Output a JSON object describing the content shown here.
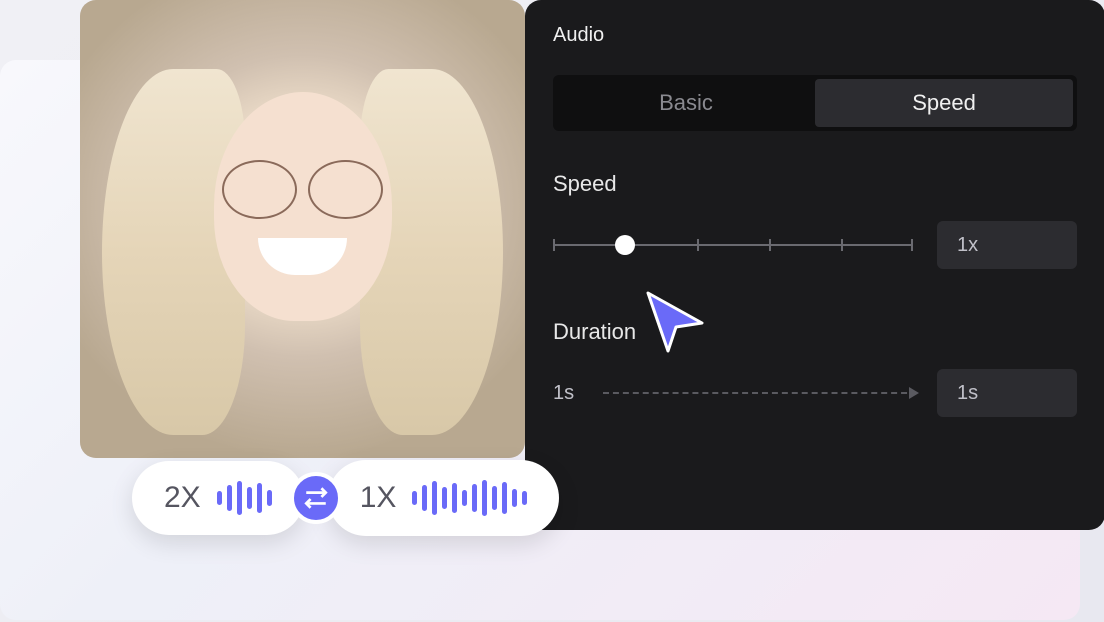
{
  "panel": {
    "title": "Audio",
    "tabs": {
      "basic": "Basic",
      "speed": "Speed",
      "active": "speed"
    },
    "speed": {
      "label": "Speed",
      "value": "1x"
    },
    "duration": {
      "label": "Duration",
      "start": "1s",
      "end": "1s"
    }
  },
  "pills": {
    "speed_2x": "2X",
    "speed_1x": "1X"
  },
  "colors": {
    "accent": "#6a6af8",
    "panel_bg": "#1a1a1c"
  }
}
